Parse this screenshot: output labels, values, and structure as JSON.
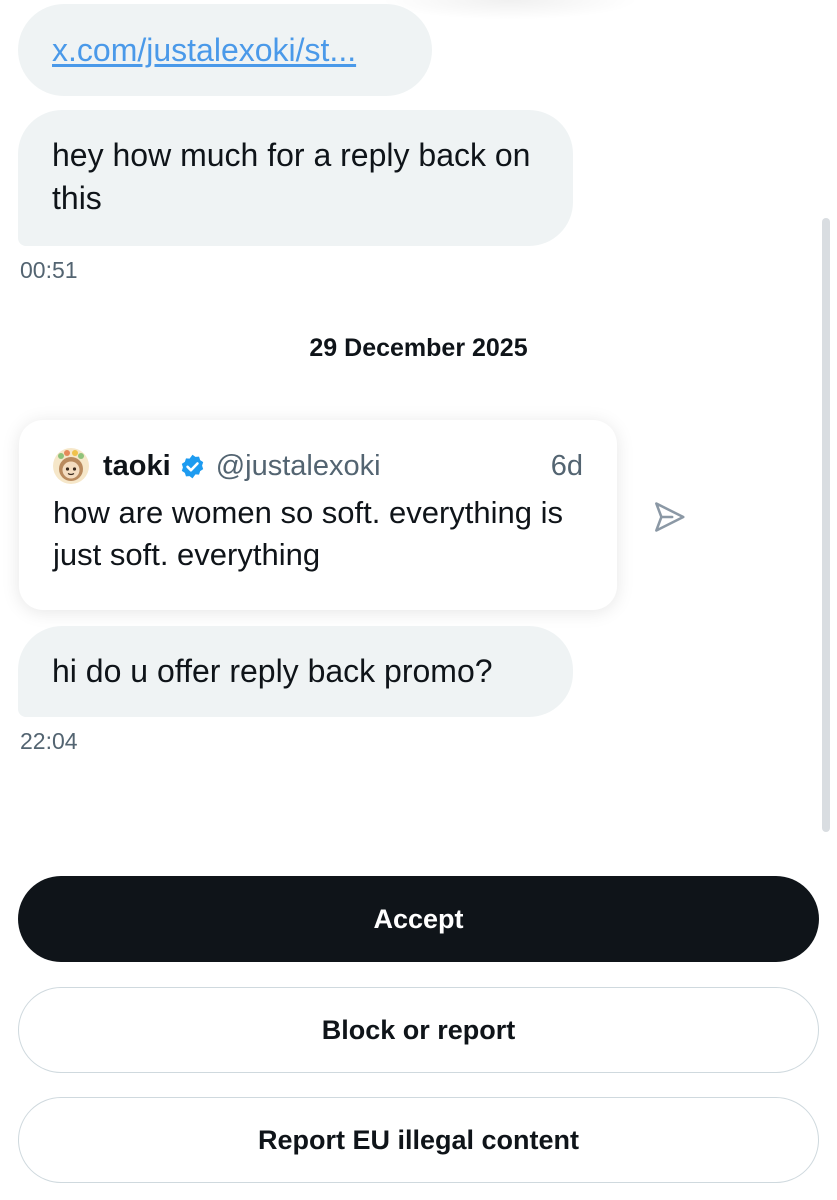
{
  "conversation": {
    "link_preview_text": "x.com/justalexoki/st...",
    "message1": "hey how much for a reply back on this",
    "message1_time": "00:51",
    "date_separator": "29 December 2025",
    "shared_post": {
      "author_name": "taoki",
      "author_handle": "@justalexoki",
      "age": "6d",
      "verified": true,
      "text": "how are women so soft. everything is just soft. everything"
    },
    "message2": "hi do u offer reply back promo?",
    "message2_time": "22:04"
  },
  "actions": {
    "accept_label": "Accept",
    "block_label": "Block or report",
    "report_eu_label": "Report EU illegal content"
  },
  "colors": {
    "bubble_bg": "#eff3f4",
    "link": "#4a99e9",
    "verified_badge": "#1d9bf0",
    "primary_button": "#0f1419",
    "secondary_text": "#536471",
    "outline": "#cfd9de"
  },
  "icons": {
    "verified": "verified-badge-icon",
    "share": "send-icon",
    "avatar": "avatar"
  }
}
